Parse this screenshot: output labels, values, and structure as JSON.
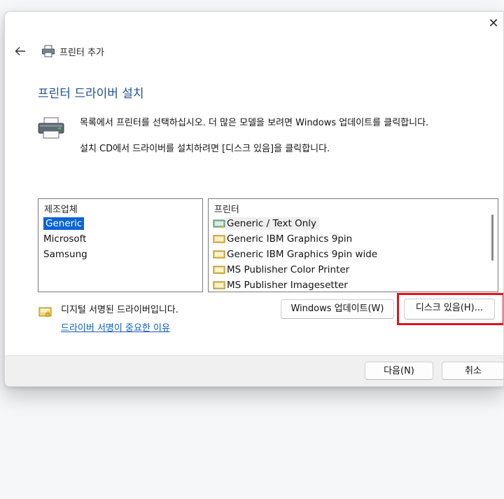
{
  "window": {
    "title": "프린터 추가",
    "close_glyph": "✕"
  },
  "page": {
    "heading": "프린터 드라이버 설치",
    "instruction_1": "목록에서 프린터를 선택하십시오. 더 많은 모델을 보려면 Windows 업데이트를 클릭합니다.",
    "instruction_2": "설치 CD에서 드라이버를 설치하려면 [디스크 있음]을 클릭합니다."
  },
  "manufacturer_list": {
    "header": "제조업체",
    "items": [
      "Generic",
      "Microsoft",
      "Samsung"
    ],
    "selected": "Generic"
  },
  "printer_list": {
    "header": "프린터",
    "items": [
      "Generic / Text Only",
      "Generic IBM Graphics 9pin",
      "Generic IBM Graphics 9pin wide",
      "MS Publisher Color Printer",
      "MS Publisher Imagesetter"
    ],
    "selected": "Generic / Text Only"
  },
  "signature": {
    "status_text": "디지털 서명된 드라이버입니다.",
    "link_text": "드라이버 서명이 중요한 이유"
  },
  "buttons": {
    "windows_update": "Windows 업데이트(W)",
    "have_disk": "디스크 있음(H)...",
    "next": "다음(N)",
    "cancel": "취소"
  },
  "colors": {
    "heading": "#1f4e99",
    "selection": "#0a64d6",
    "link": "#0b5cc7",
    "highlight": "#e0141c"
  },
  "icons": {
    "back": "back-arrow-icon",
    "title": "printer-icon",
    "instruction": "printer-icon",
    "signature": "certificate-icon"
  }
}
